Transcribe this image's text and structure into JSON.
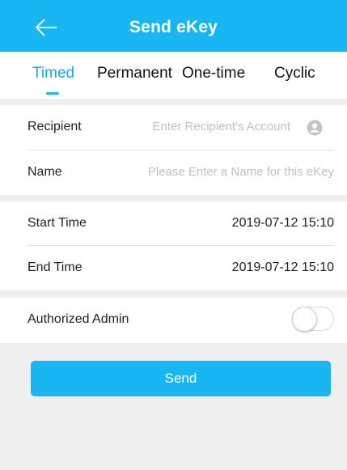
{
  "header": {
    "title": "Send eKey",
    "back_icon": "arrow-left-icon",
    "background_color": "#17b6f2"
  },
  "tabs": [
    {
      "label": "Timed",
      "active": true
    },
    {
      "label": "Permanent",
      "active": false
    },
    {
      "label": "One-time",
      "active": false
    },
    {
      "label": "Cyclic",
      "active": false
    }
  ],
  "recipient": {
    "label": "Recipient",
    "placeholder": "Enter Recipient's Account",
    "icon": "contact-icon"
  },
  "name": {
    "label": "Name",
    "placeholder": "Please Enter a Name for this eKey"
  },
  "start_time": {
    "label": "Start Time",
    "value": "2019-07-12 15:10"
  },
  "end_time": {
    "label": "End Time",
    "value": "2019-07-12 15:10"
  },
  "authorized_admin": {
    "label": "Authorized Admin",
    "enabled": false
  },
  "send_button": {
    "label": "Send",
    "color": "#17b6f2"
  }
}
